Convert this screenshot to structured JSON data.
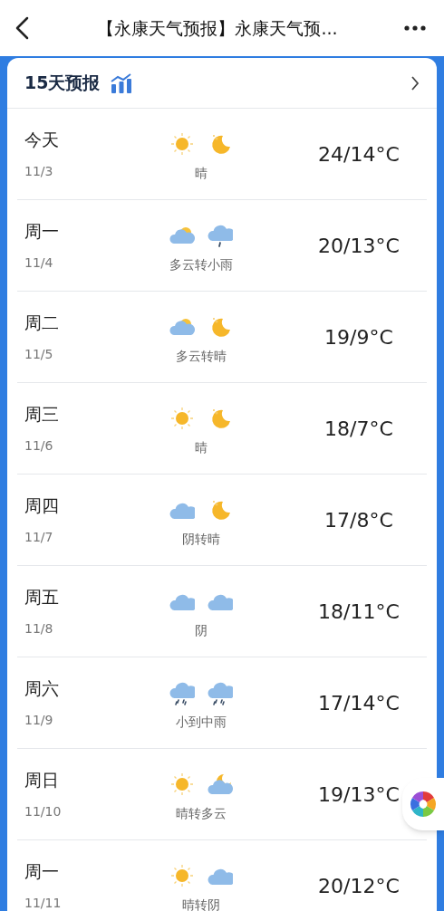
{
  "nav": {
    "title": "【永康天气预报】永康天气预..."
  },
  "forecast": {
    "title": "15天预报",
    "days": [
      {
        "day": "今天",
        "date": "11/3",
        "icons": [
          {
            "kind": "sun"
          },
          {
            "kind": "moon"
          }
        ],
        "desc": "晴",
        "temp": "24/14°C"
      },
      {
        "day": "周一",
        "date": "11/4",
        "icons": [
          {
            "kind": "partlycloudy"
          },
          {
            "kind": "drizzle"
          }
        ],
        "desc": "多云转小雨",
        "temp": "20/13°C"
      },
      {
        "day": "周二",
        "date": "11/5",
        "icons": [
          {
            "kind": "partlycloudy"
          },
          {
            "kind": "moon"
          }
        ],
        "desc": "多云转晴",
        "temp": "19/9°C"
      },
      {
        "day": "周三",
        "date": "11/6",
        "icons": [
          {
            "kind": "sun"
          },
          {
            "kind": "moon"
          }
        ],
        "desc": "晴",
        "temp": "18/7°C"
      },
      {
        "day": "周四",
        "date": "11/7",
        "icons": [
          {
            "kind": "cloud"
          },
          {
            "kind": "moon"
          }
        ],
        "desc": "阴转晴",
        "temp": "17/8°C"
      },
      {
        "day": "周五",
        "date": "11/8",
        "icons": [
          {
            "kind": "cloud"
          },
          {
            "kind": "cloud"
          }
        ],
        "desc": "阴",
        "temp": "18/11°C"
      },
      {
        "day": "周六",
        "date": "11/9",
        "icons": [
          {
            "kind": "rain"
          },
          {
            "kind": "rain"
          }
        ],
        "desc": "小到中雨",
        "temp": "17/14°C"
      },
      {
        "day": "周日",
        "date": "11/10",
        "icons": [
          {
            "kind": "sun"
          },
          {
            "kind": "cloudmoon"
          }
        ],
        "desc": "晴转多云",
        "temp": "19/13°C"
      },
      {
        "day": "周一",
        "date": "11/11",
        "icons": [
          {
            "kind": "sun"
          },
          {
            "kind": "cloud"
          }
        ],
        "desc": "晴转阴",
        "temp": "20/12°C"
      }
    ]
  }
}
